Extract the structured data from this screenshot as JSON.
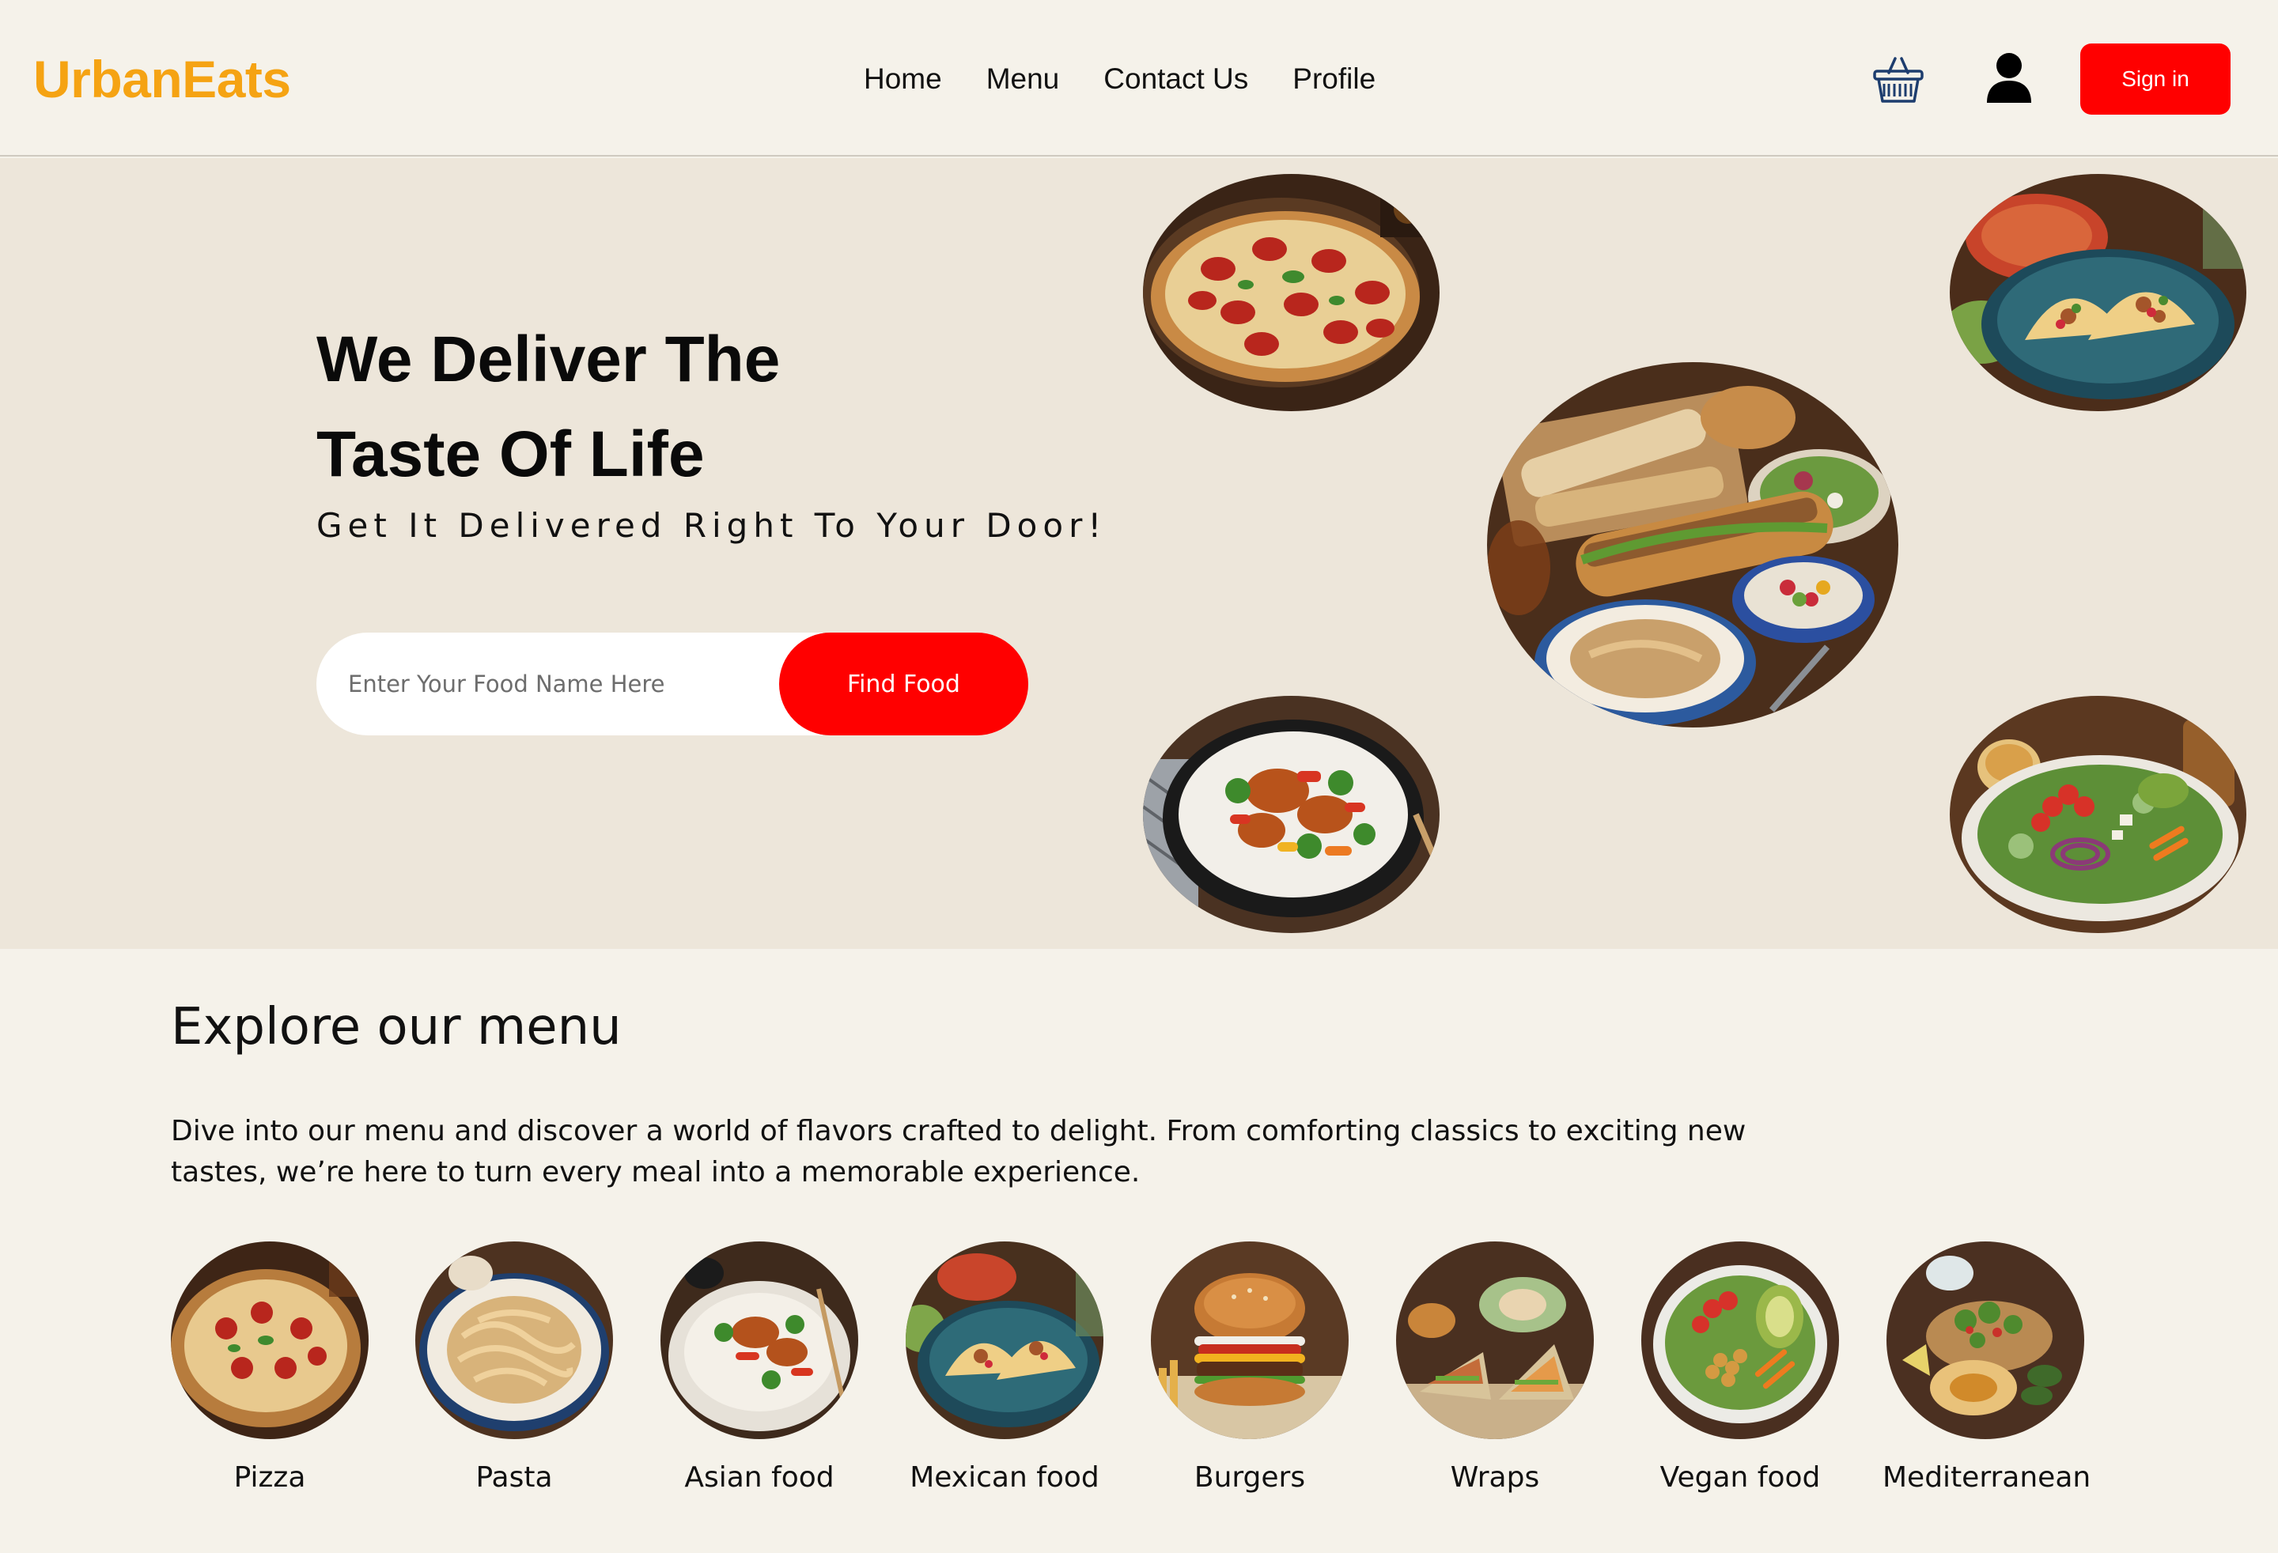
{
  "brand": {
    "name": "UrbanEats",
    "color": "#f5a313"
  },
  "nav": {
    "items": [
      "Home",
      "Menu",
      "Contact Us",
      "Profile"
    ]
  },
  "header": {
    "cart_icon": "shopping-basket-icon",
    "user_icon": "user-icon",
    "signin_label": "Sign in"
  },
  "hero": {
    "title_line1": "We Deliver The",
    "title_line2": "Taste Of Life",
    "subtitle": "Get It Delivered Right To Your Door!",
    "search_placeholder": "Enter Your Food Name Here",
    "find_button": "Find Food"
  },
  "menu": {
    "title": "Explore our menu",
    "description": "Dive into our menu and discover a world of flavors crafted to delight. From comforting classics to exciting new tastes, we’re here to turn every meal into a memorable experience.",
    "categories": [
      {
        "label": "Pizza"
      },
      {
        "label": "Pasta"
      },
      {
        "label": "Asian food"
      },
      {
        "label": "Mexican food"
      },
      {
        "label": "Burgers"
      },
      {
        "label": "Wraps"
      },
      {
        "label": "Vegan food"
      },
      {
        "label": "Mediterranean"
      }
    ]
  },
  "colors": {
    "accent_red": "#ff0000",
    "page_bg": "#f5f2ea",
    "hero_bg": "#ede6da"
  }
}
